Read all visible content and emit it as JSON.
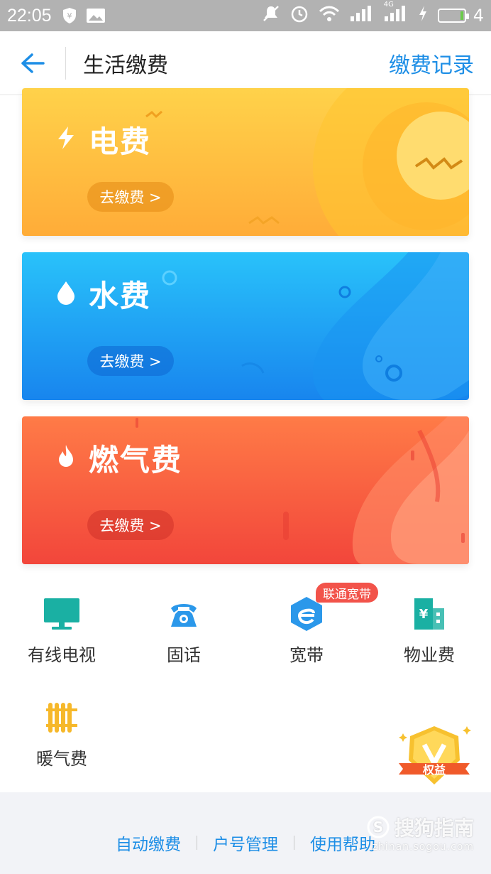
{
  "status_bar": {
    "time": "22:05",
    "battery_text": "4",
    "signal_label": "4G"
  },
  "header": {
    "title": "生活缴费",
    "right_link": "缴费记录"
  },
  "cards": [
    {
      "title": "电费",
      "button_label": "去缴费 >",
      "icon": "lightning-icon",
      "color_top": "#ffd24a",
      "color_bottom": "#ffac38"
    },
    {
      "title": "水费",
      "button_label": "去缴费 >",
      "icon": "water-drop-icon",
      "color_top": "#29c2fa",
      "color_bottom": "#1885ee"
    },
    {
      "title": "燃气费",
      "button_label": "去缴费 >",
      "icon": "flame-icon",
      "color_top": "#ff7b47",
      "color_bottom": "#f2463b"
    }
  ],
  "services": [
    {
      "label": "有线电视",
      "icon": "tv-icon",
      "color": "#1ab0a3"
    },
    {
      "label": "固话",
      "icon": "telephone-icon",
      "color": "#2b98ea"
    },
    {
      "label": "宽带",
      "icon": "broadband-icon",
      "color": "#2b98ea",
      "badge": "联通宽带"
    },
    {
      "label": "物业费",
      "icon": "building-icon",
      "color": "#1ab0a3"
    },
    {
      "label": "暖气费",
      "icon": "radiator-icon",
      "color": "#f6b82a"
    }
  ],
  "vip_badge": {
    "label": "权益"
  },
  "footer": {
    "links": [
      "自动缴费",
      "户号管理",
      "使用帮助"
    ]
  },
  "watermark": {
    "text": "搜狗指南",
    "url": "zhinan.sogou.com"
  }
}
